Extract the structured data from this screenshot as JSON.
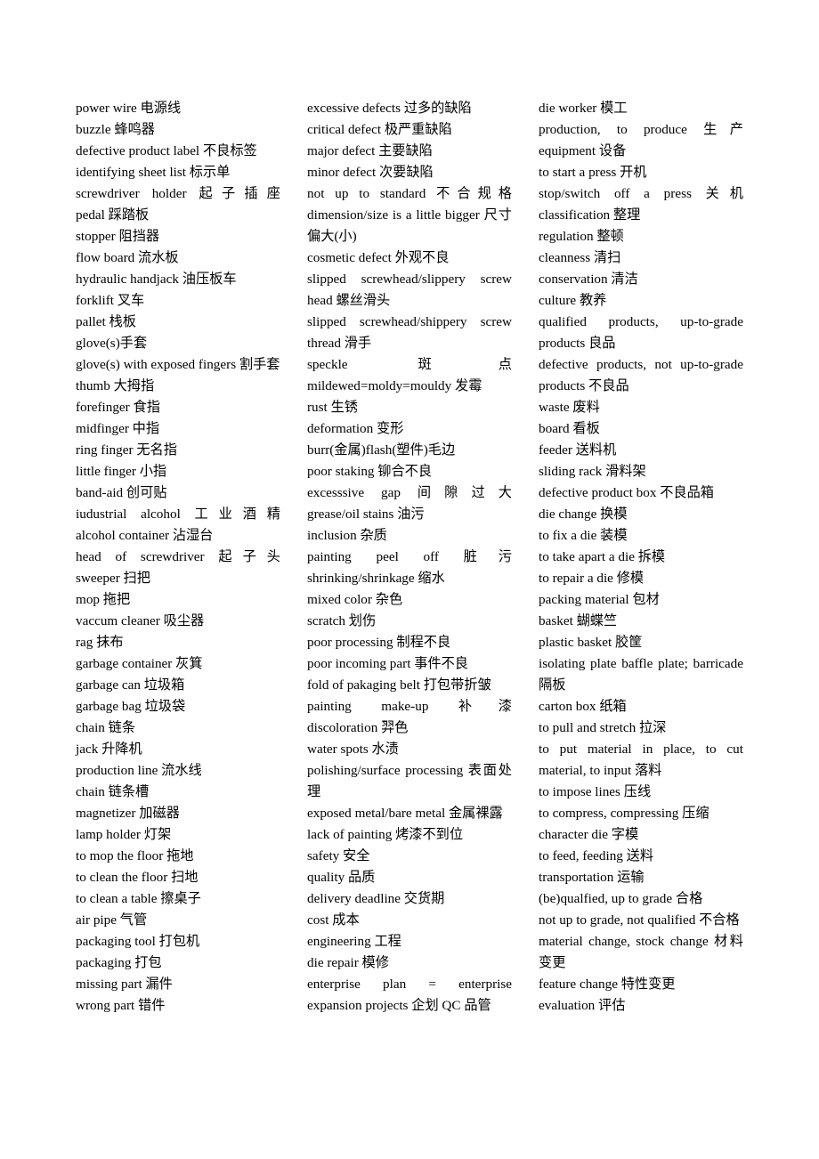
{
  "document": {
    "kind": "bilingual-glossary",
    "page_background": "#ffffff",
    "text_color": "#000000",
    "column_count": 3
  },
  "columns": [
    {
      "name": "column-1",
      "entries": [
        {
          "text": "power wire 电源线",
          "stretch": false
        },
        {
          "text": "buzzle 蜂鸣器",
          "stretch": false
        },
        {
          "text": "defective product label 不良标签",
          "stretch": false
        },
        {
          "text": "identifying sheet list 标示单",
          "stretch": false
        },
        {
          "text": "screwdriver holder 起子插座",
          "stretch": true
        },
        {
          "text": "pedal 踩踏板",
          "stretch": false
        },
        {
          "text": "stopper 阻挡器",
          "stretch": false
        },
        {
          "text": "flow board 流水板",
          "stretch": false
        },
        {
          "text": "hydraulic handjack 油压板车",
          "stretch": false
        },
        {
          "text": "forklift 叉车",
          "stretch": false
        },
        {
          "text": "pallet 栈板",
          "stretch": false
        },
        {
          "text": "glove(s)手套",
          "stretch": false
        },
        {
          "text": "glove(s) with exposed fingers 割手套",
          "stretch": false
        },
        {
          "text": "thumb 大拇指",
          "stretch": false
        },
        {
          "text": "forefinger 食指",
          "stretch": false
        },
        {
          "text": "midfinger 中指",
          "stretch": false
        },
        {
          "text": "ring finger 无名指",
          "stretch": false
        },
        {
          "text": "little finger 小指",
          "stretch": false
        },
        {
          "text": "band-aid 创可贴",
          "stretch": false
        },
        {
          "text": "iudustrial alcohol 工业酒精",
          "stretch": true
        },
        {
          "text": "alcohol container 沾湿台",
          "stretch": false
        },
        {
          "text": "head of screwdriver 起子头",
          "stretch": true
        },
        {
          "text": "sweeper 扫把",
          "stretch": false
        },
        {
          "text": "mop 拖把",
          "stretch": false
        },
        {
          "text": "vaccum cleaner 吸尘器",
          "stretch": false
        },
        {
          "text": "rag 抹布",
          "stretch": false
        },
        {
          "text": "garbage container 灰箕",
          "stretch": false
        },
        {
          "text": "garbage can 垃圾箱",
          "stretch": false
        },
        {
          "text": "garbage bag 垃圾袋",
          "stretch": false
        },
        {
          "text": "chain 链条",
          "stretch": false
        },
        {
          "text": "jack 升降机",
          "stretch": false
        },
        {
          "text": "production line 流水线",
          "stretch": false
        },
        {
          "text": "chain 链条槽",
          "stretch": false
        },
        {
          "text": "magnetizer 加磁器",
          "stretch": false
        },
        {
          "text": "lamp holder 灯架",
          "stretch": false
        },
        {
          "text": "to mop the floor 拖地",
          "stretch": false
        },
        {
          "text": "to clean the floor 扫地",
          "stretch": false
        },
        {
          "text": "to clean a table 擦桌子",
          "stretch": false
        },
        {
          "text": "air pipe 气管",
          "stretch": false
        },
        {
          "text": "packaging tool 打包机",
          "stretch": false
        },
        {
          "text": "packaging 打包",
          "stretch": false
        },
        {
          "text": "missing part 漏件",
          "stretch": false
        },
        {
          "text": "wrong part 错件",
          "stretch": false
        }
      ]
    },
    {
      "name": "column-2",
      "entries": [
        {
          "text": "excessive defects 过多的缺陷",
          "stretch": false
        },
        {
          "text": "critical defect 极严重缺陷",
          "stretch": false
        },
        {
          "text": "major defect 主要缺陷",
          "stretch": false
        },
        {
          "text": "minor defect 次要缺陷",
          "stretch": false
        },
        {
          "text": "not up to standard 不合规格",
          "stretch": true
        },
        {
          "text": "dimension/size is a little bigger 尺寸偏大(小)",
          "stretch": false
        },
        {
          "text": "cosmetic defect 外观不良",
          "stretch": false
        },
        {
          "text": "slipped screwhead/slippery screw head 螺丝滑头",
          "stretch": false
        },
        {
          "text": "slipped screwhead/shippery screw thread 滑手",
          "stretch": false
        },
        {
          "text": "speckle 斑点",
          "stretch": true
        },
        {
          "text": "mildewed=moldy=mouldy 发霉",
          "stretch": false
        },
        {
          "text": "rust 生锈",
          "stretch": false
        },
        {
          "text": "deformation 变形",
          "stretch": false
        },
        {
          "text": "burr(金属)flash(塑件)毛边",
          "stretch": false
        },
        {
          "text": "poor staking 铆合不良",
          "stretch": false
        },
        {
          "text": "excesssive gap 间隙过大",
          "stretch": true
        },
        {
          "text": "grease/oil stains 油污",
          "stretch": false
        },
        {
          "text": "inclusion 杂质",
          "stretch": false
        },
        {
          "text": "painting peel off 脏污",
          "stretch": true
        },
        {
          "text": "shrinking/shrinkage 缩水",
          "stretch": false
        },
        {
          "text": "mixed color 杂色",
          "stretch": false
        },
        {
          "text": "scratch 划伤",
          "stretch": false
        },
        {
          "text": "poor processing 制程不良",
          "stretch": false
        },
        {
          "text": "poor incoming part 事件不良",
          "stretch": false
        },
        {
          "text": "fold of pakaging belt 打包带折皱",
          "stretch": false
        },
        {
          "text": "painting make-up 补漆",
          "stretch": true
        },
        {
          "text": "discoloration 羿色",
          "stretch": false
        },
        {
          "text": "water spots 水渍",
          "stretch": false
        },
        {
          "text": "polishing/surface processing 表面处理",
          "stretch": false
        },
        {
          "text": "exposed metal/bare metal 金属裸露",
          "stretch": false
        },
        {
          "text": "lack of painting 烤漆不到位",
          "stretch": false
        },
        {
          "text": "safety 安全",
          "stretch": false
        },
        {
          "text": "quality 品质",
          "stretch": false
        },
        {
          "text": "delivery deadline 交货期",
          "stretch": false
        },
        {
          "text": "cost 成本",
          "stretch": false
        },
        {
          "text": "engineering 工程",
          "stretch": false
        },
        {
          "text": "die repair 模修",
          "stretch": false
        },
        {
          "text": "enterprise plan = enterprise expansion projects 企划  QC 品管",
          "stretch": false
        }
      ]
    },
    {
      "name": "column-3",
      "entries": [
        {
          "text": "die worker 模工",
          "stretch": false
        },
        {
          "text": "production, to produce 生产",
          "stretch": true
        },
        {
          "text": "equipment 设备",
          "stretch": false
        },
        {
          "text": "to start a press 开机",
          "stretch": false
        },
        {
          "text": "stop/switch off a press 关机",
          "stretch": true
        },
        {
          "text": "classification 整理",
          "stretch": false
        },
        {
          "text": "regulation 整顿",
          "stretch": false
        },
        {
          "text": "cleanness 清扫",
          "stretch": false
        },
        {
          "text": "conservation 清洁",
          "stretch": false
        },
        {
          "text": "culture 教养",
          "stretch": false
        },
        {
          "text": "qualified products, up-to-grade products 良品",
          "stretch": false
        },
        {
          "text": "defective products, not up-to-grade products 不良品",
          "stretch": false
        },
        {
          "text": "waste 废料",
          "stretch": false
        },
        {
          "text": "board 看板",
          "stretch": false
        },
        {
          "text": "feeder 送料机",
          "stretch": false
        },
        {
          "text": "sliding rack 滑料架",
          "stretch": false
        },
        {
          "text": "defective product box 不良品箱",
          "stretch": false
        },
        {
          "text": "die change 换模",
          "stretch": false
        },
        {
          "text": "to fix a die 装模",
          "stretch": false
        },
        {
          "text": "to take apart a die 拆模",
          "stretch": false
        },
        {
          "text": "to repair a die 修模",
          "stretch": false
        },
        {
          "text": "packing material 包材",
          "stretch": false
        },
        {
          "text": "basket 蝴蝶竺",
          "stretch": false
        },
        {
          "text": "plastic basket 胶筐",
          "stretch": false
        },
        {
          "text": "isolating plate baffle plate; barricade 隔板",
          "stretch": false
        },
        {
          "text": "carton box 纸箱",
          "stretch": false
        },
        {
          "text": "to pull and stretch 拉深",
          "stretch": false
        },
        {
          "text": "to put material in place, to cut material, to input 落料",
          "stretch": false
        },
        {
          "text": "to impose lines 压线",
          "stretch": false
        },
        {
          "text": "to compress, compressing 压缩",
          "stretch": false
        },
        {
          "text": "character die 字模",
          "stretch": false
        },
        {
          "text": "to feed, feeding 送料",
          "stretch": false
        },
        {
          "text": "transportation 运输",
          "stretch": false
        },
        {
          "text": "(be)qualfied, up to grade 合格",
          "stretch": false
        },
        {
          "text": "not up to grade, not qualified 不合格",
          "stretch": false
        },
        {
          "text": "material change, stock change 材料变更",
          "stretch": false
        },
        {
          "text": "feature change 特性变更",
          "stretch": false
        },
        {
          "text": "evaluation 评估",
          "stretch": false
        }
      ]
    }
  ]
}
